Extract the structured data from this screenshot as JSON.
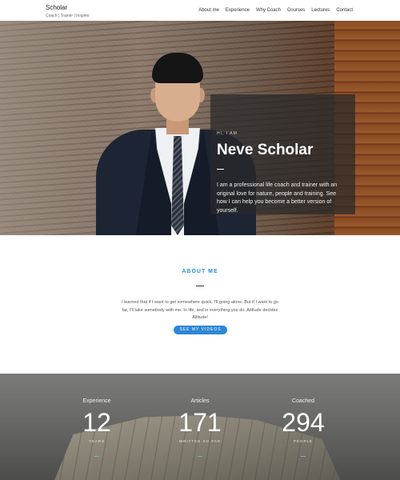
{
  "header": {
    "brand": "Scholar",
    "tagline": "Coach | Trainer | Inspirer",
    "nav": [
      "About me",
      "Experience",
      "Why Coach",
      "Courses",
      "Lectures",
      "Contact"
    ]
  },
  "hero": {
    "eyebrow": "HI, I AM",
    "title": "Neve Scholar",
    "description": "I am a professional life coach and trainer with an original love for nature, people and training. See how I can help you become a better version of yourself."
  },
  "about": {
    "title": "ABOUT ME",
    "text": "I learned that if I want to get somewhere quick, I'll going alone. But if I want to go far, I'll take somebody with me. In life, and in everything you do, Attitude decides Altitude!",
    "button_label": "SEE MY VIDEOS"
  },
  "stats": [
    {
      "label": "Experience",
      "value": "12",
      "sub": "YEARS"
    },
    {
      "label": "Articles",
      "value": "171",
      "sub": "WRITTEN SO FAR"
    },
    {
      "label": "Coached",
      "value": "294",
      "sub": "PEOPLE"
    }
  ],
  "colors": {
    "accent": "#2e86d6",
    "about_title": "#2a8fd6"
  }
}
